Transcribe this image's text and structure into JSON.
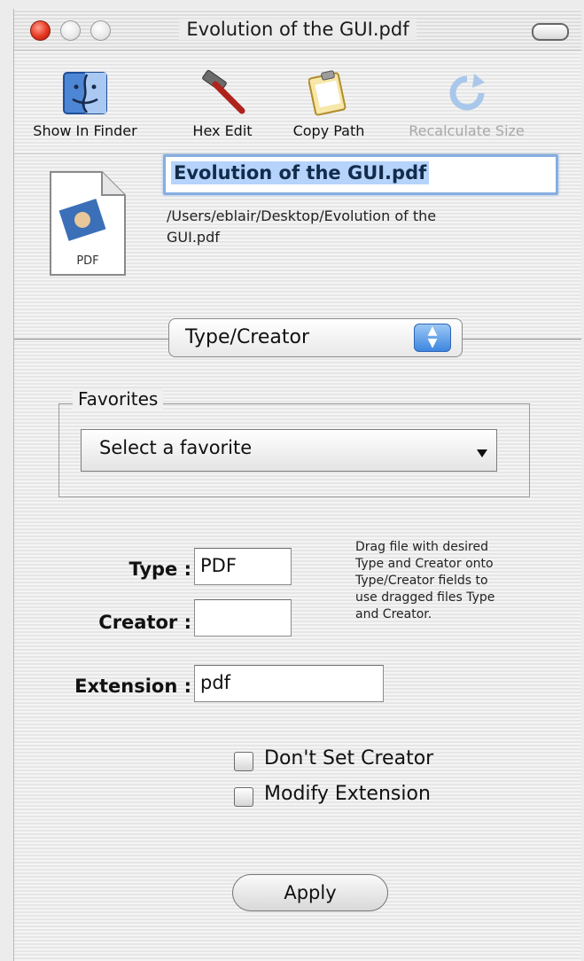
{
  "window": {
    "title": "Evolution of the GUI.pdf"
  },
  "toolbar": {
    "show_in_finder": "Show In Finder",
    "hex_edit": "Hex Edit",
    "copy_path": "Copy Path",
    "recalculate_size": "Recalculate Size"
  },
  "file": {
    "name": "Evolution of the GUI.pdf",
    "path_line1": "/Users/eblair/Desktop/Evolution of the",
    "path_line2": "GUI.pdf",
    "icon_label": "PDF"
  },
  "section_popup": {
    "selected": "Type/Creator"
  },
  "favorites": {
    "legend": "Favorites",
    "selected": "Select a favorite"
  },
  "fields": {
    "type_label": "Type :",
    "type_value": "PDF",
    "creator_label": "Creator :",
    "creator_value": "",
    "extension_label": "Extension :",
    "extension_value": "pdf"
  },
  "help_text": [
    "Drag file with desired",
    "Type and Creator onto",
    "Type/Creator fields to",
    "use dragged files Type",
    "and Creator."
  ],
  "checkboxes": {
    "dont_set_creator": "Don't Set Creator",
    "modify_extension": "Modify Extension"
  },
  "apply_button": "Apply"
}
